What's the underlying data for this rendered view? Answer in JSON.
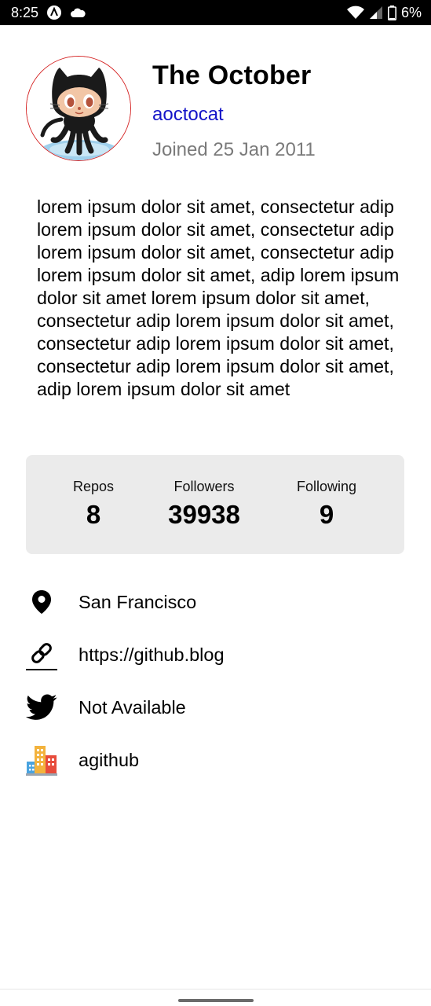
{
  "status_bar": {
    "time": "8:25",
    "battery": "6%"
  },
  "profile": {
    "name": "The October",
    "username": "aoctocat",
    "joined": "Joined 25 Jan 2011"
  },
  "bio": "lorem ipsum dolor sit amet, consectetur adip lorem ipsum dolor sit amet, consectetur adip lorem ipsum dolor sit amet, consectetur adip lorem ipsum dolor sit amet, adip lorem ipsum dolor sit amet lorem ipsum dolor sit amet, consectetur adip lorem ipsum dolor sit amet, consectetur adip lorem ipsum dolor sit amet, consectetur adip lorem ipsum dolor sit amet, adip lorem ipsum dolor sit amet",
  "stats": {
    "repos_label": "Repos",
    "repos_value": "8",
    "followers_label": "Followers",
    "followers_value": "39938",
    "following_label": "Following",
    "following_value": "9"
  },
  "info": {
    "location": "San Francisco",
    "blog": "https://github.blog",
    "twitter": "Not Available",
    "company": "agithub"
  },
  "icons": {
    "location": "location-pin-icon",
    "blog": "link-icon",
    "twitter": "twitter-bird-icon",
    "company": "office-buildings-icon"
  },
  "colors": {
    "username": "#1515c8",
    "joined": "#7a7a7a",
    "stats_card": "#ebebeb",
    "avatar_border": "#d62828"
  }
}
